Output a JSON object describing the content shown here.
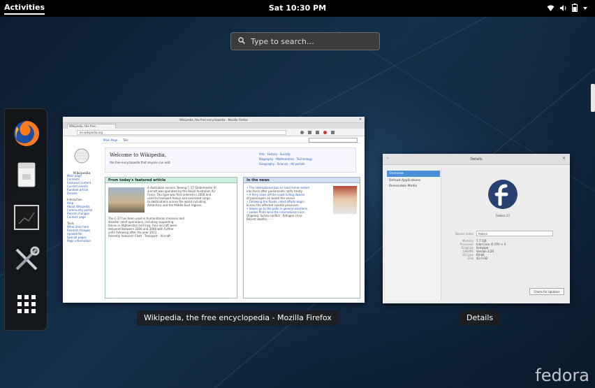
{
  "topbar": {
    "activities": "Activities",
    "clock": "Sat 10:30 PM",
    "icons": [
      "network-icon",
      "volume-icon",
      "battery-icon",
      "power-menu-icon"
    ]
  },
  "search": {
    "placeholder": "Type to search…"
  },
  "dash": {
    "apps": [
      "firefox-icon",
      "files-icon",
      "screenshot-icon",
      "settings-tools-icon",
      "show-apps-icon"
    ]
  },
  "windows": {
    "firefox": {
      "caption": "Wikipedia, the free encyclopedia - Mozilla Firefox",
      "title": "Wikipedia, the free encyclopedia - Mozilla Firefox",
      "tab": "Wikipedia, the free...",
      "url": "en.wikipedia.org",
      "welcome": "Welcome to Wikipedia,",
      "featured_heading": "From today's featured article",
      "news_heading": "In the news",
      "logo_text": "Wikipedia"
    },
    "details": {
      "caption": "Details",
      "title": "Details",
      "sidebar": [
        "Overview",
        "Default Applications",
        "Removable Media"
      ],
      "os_name": "Fedora 27",
      "device_name_value": "fedora",
      "button": "Check for Updates"
    }
  },
  "watermark": "fedora",
  "colors": {
    "accent": "#4a90d9",
    "topbar": "#000000",
    "fedora_blue": "#294172"
  }
}
